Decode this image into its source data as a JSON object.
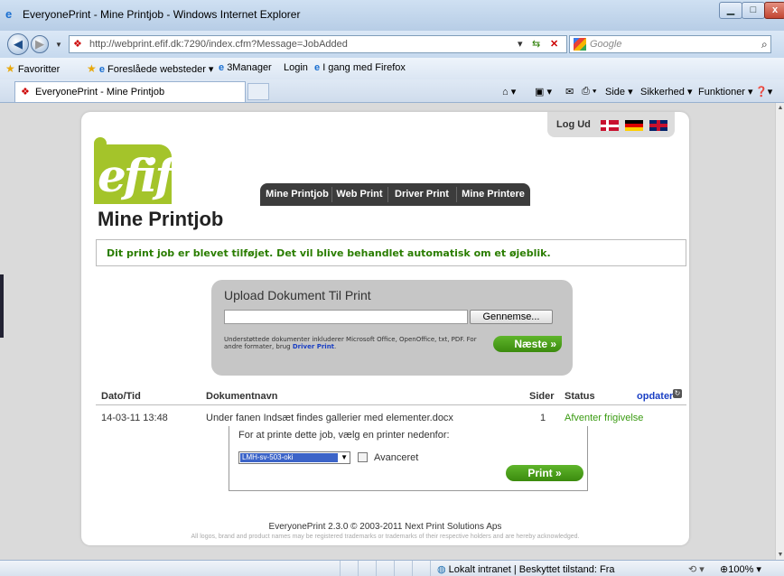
{
  "window": {
    "title": "EveryonePrint - Mine Printjob - Windows Internet Explorer",
    "min": "▁",
    "max": "□",
    "close": "x"
  },
  "address": {
    "url": "http://webprint.efif.dk:7290/index.cfm?Message=JobAdded",
    "search_placeholder": "Google"
  },
  "favorites": {
    "favorites_label": "Favoritter",
    "suggested_label": "Foreslåede websteder ▾",
    "items": [
      "3Manager",
      "Login",
      "I gang med Firefox"
    ]
  },
  "tabs": {
    "active_label": "EveryonePrint - Mine Printjob",
    "commands": [
      "Side ▾",
      "Sikkerhed ▾",
      "Funktioner ▾"
    ]
  },
  "header": {
    "logout": "Log Ud",
    "logo_text": "efif"
  },
  "nav": {
    "items": [
      "Mine Printjob",
      "Web Print",
      "Driver Print",
      "Mine Printere"
    ]
  },
  "page": {
    "title": "Mine Printjob",
    "message": "Dit print job er blevet tilføjet. Det vil blive behandlet automatisk om et øjeblik."
  },
  "upload": {
    "title": "Upload Dokument Til Print",
    "browse": "Gennemse...",
    "supported": "Understøttede dokumenter inkluderer Microsoft Office, OpenOffice, txt, PDF. For andre formater, brug",
    "supported_link": "Driver Print",
    "next": "Næste »"
  },
  "jobs": {
    "headers": {
      "date": "Dato/Tid",
      "name": "Dokumentnavn",
      "pages": "Sider",
      "status": "Status",
      "refresh": "opdater"
    },
    "rows": [
      {
        "date": "14-03-11 13:48",
        "name": "Under fanen Indsæt findes gallerier med elementer.docx",
        "pages": "1",
        "status": "Afventer frigivelse"
      }
    ],
    "print_prompt": "For at printe dette job, vælg en printer nedenfor:",
    "printer_selected": "LMH-sv-503-oki",
    "advanced_label": "Avanceret",
    "print_button": "Print »"
  },
  "footer": {
    "version": "EveryonePrint 2.3.0 © 2003-2011 Next Print Solutions Aps",
    "trademark": "All logos, brand and product names may be registered trademarks or trademarks of their respective holders and are hereby acknowledged."
  },
  "statusbar": {
    "zone": "Lokalt intranet | Beskyttet tilstand: Fra",
    "zoom": "100%"
  },
  "colors": {
    "brand_green": "#a4c42a",
    "message_green": "#2a7d00",
    "button_green": "#4ea21c",
    "link_blue": "#1a3fc4"
  }
}
